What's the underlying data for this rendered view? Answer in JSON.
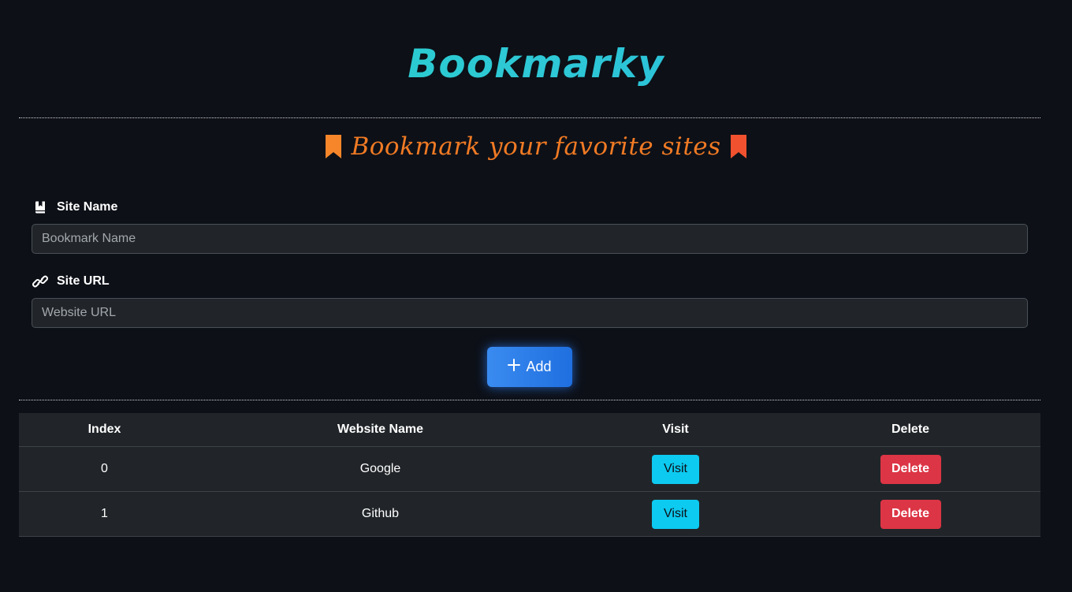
{
  "app": {
    "title": "Bookmarky",
    "tagline": "Bookmark your favorite sites"
  },
  "form": {
    "name_label": "Site Name",
    "name_placeholder": "Bookmark Name",
    "name_value": "",
    "url_label": "Site URL",
    "url_placeholder": "Website URL",
    "url_value": "",
    "add_label": "Add",
    "name_icon": "book-bookmark-icon",
    "url_icon": "link-icon",
    "add_icon": "plus-icon"
  },
  "table": {
    "headers": [
      "Index",
      "Website Name",
      "Visit",
      "Delete"
    ],
    "rows": [
      {
        "index": "0",
        "name": "Google",
        "visit_label": "Visit",
        "delete_label": "Delete"
      },
      {
        "index": "1",
        "name": "Github",
        "visit_label": "Visit",
        "delete_label": "Delete"
      }
    ]
  },
  "colors": {
    "background": "#0d1017",
    "title_gradient_start": "#22d3bf",
    "title_gradient_end": "#24b6e0",
    "tagline": "#f07a24",
    "ribbon_left": "#f7862a",
    "ribbon_right": "#f2512f",
    "add_button": "#1f6fe0",
    "visit_button": "#0dcaf0",
    "delete_button": "#dc3545"
  },
  "icons": {
    "tagline_left": "bookmark-ribbon-icon",
    "tagline_right": "bookmark-ribbon-icon"
  }
}
